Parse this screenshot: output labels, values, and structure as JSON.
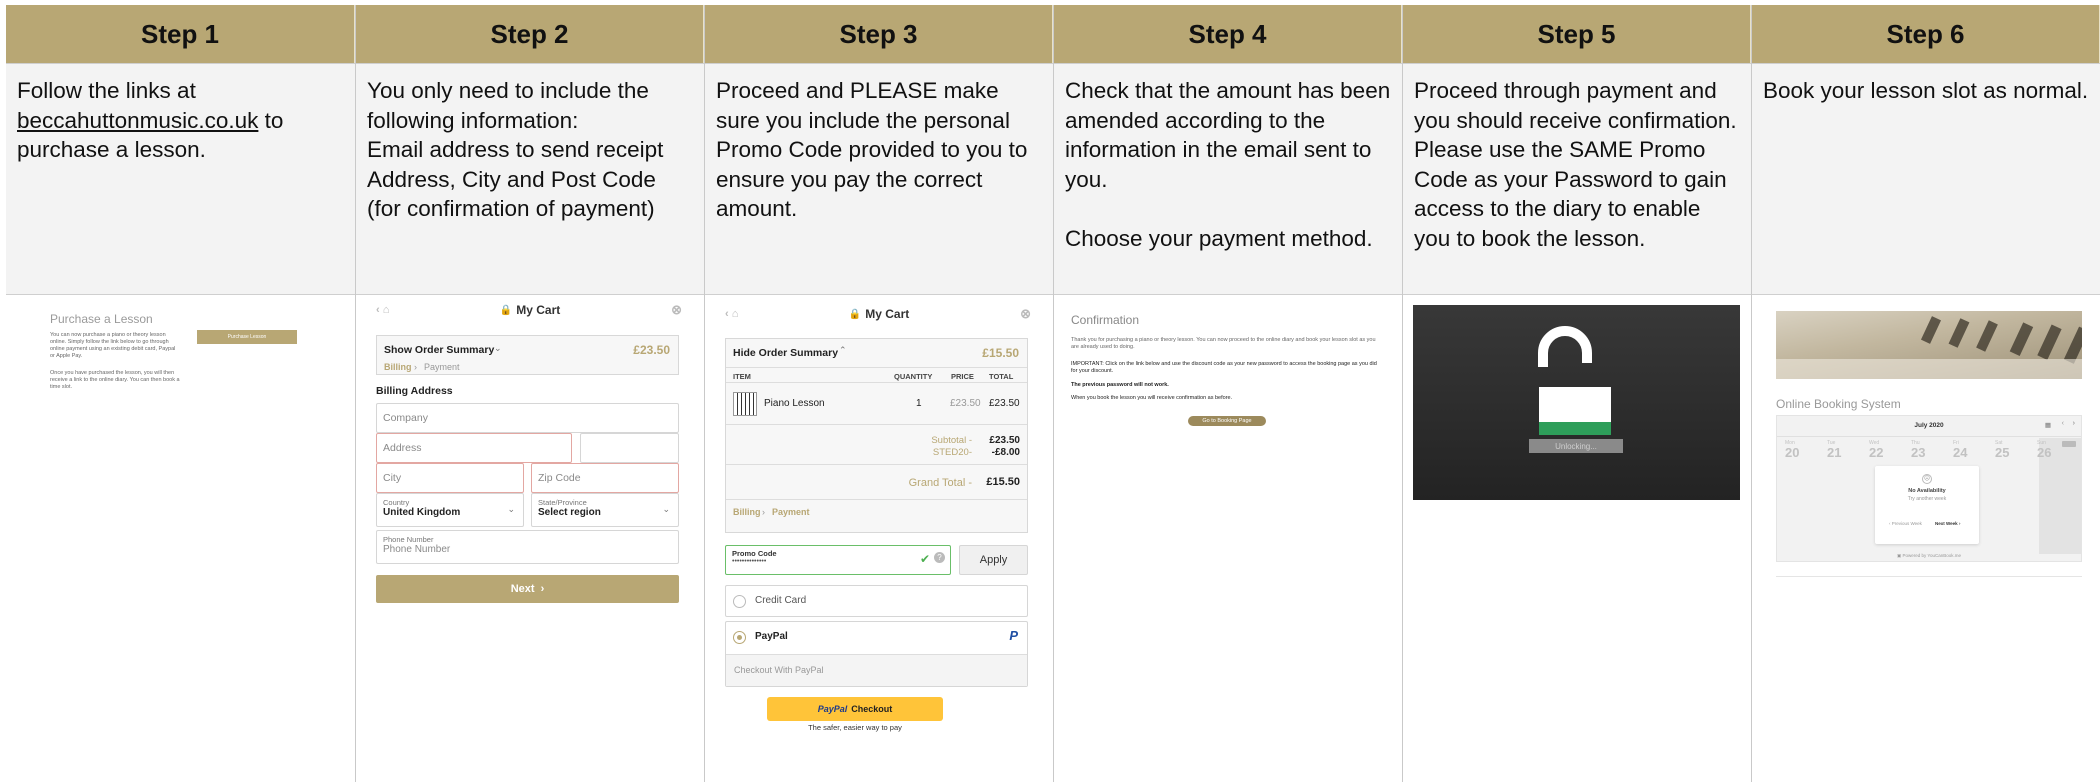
{
  "steps": [
    {
      "title": "Step 1",
      "text": ""
    },
    {
      "title": "Step 2",
      "text": "You only need to include the following information:\nEmail address to send receipt\nAddress, City and Post Code (for confirmation of payment)"
    },
    {
      "title": "Step 3",
      "text": "Proceed and PLEASE make sure you include the personal Promo Code provided to you to ensure you pay the correct amount."
    },
    {
      "title": "Step 4",
      "text": "Check that the amount has been amended according to the information in the email sent to you.\n\nChoose your payment method."
    },
    {
      "title": "Step 5",
      "text": "Proceed through payment and you should receive confirmation. Please use the SAME Promo Code as your Password to gain access to the diary to enable you to book the lesson."
    },
    {
      "title": "Step 6",
      "text": "Book your lesson slot as normal."
    }
  ],
  "step1": {
    "text_before": "Follow the links at ",
    "link": "beccahuttonmusic.co.uk",
    "text_after": " to purchase a lesson.",
    "shot_title": "Purchase a Lesson",
    "shot_para1": "You can now purchase a piano or theory lesson online. Simply follow the link below to go through online payment using an existing debit card, Paypal or Apple Pay.",
    "shot_para2": "Once you have purchased the lesson, you will then receive a link to the online diary. You can then book a time slot.",
    "shot_button": "Purchase Lesson"
  },
  "step2": {
    "cart_title": "My Cart",
    "summary_label": "Show Order Summary",
    "summary_total": "£23.50",
    "crumb_billing": "Billing",
    "crumb_payment": "Payment",
    "section": "Billing Address",
    "company": "Company",
    "address": "Address",
    "city": "City",
    "zip": "Zip Code",
    "country_label": "Country",
    "country_value": "United Kingdom",
    "state_label": "State/Province",
    "state_value": "Select region",
    "phone_label": "Phone Number",
    "phone_placeholder": "Phone Number",
    "next": "Next"
  },
  "step3": {
    "cart_title": "My Cart",
    "summary_label": "Hide Order Summary",
    "summary_total": "£15.50",
    "col_item": "ITEM",
    "col_qty": "QUANTITY",
    "col_price": "PRICE",
    "col_total": "TOTAL",
    "item_name": "Piano Lesson",
    "item_qty": "1",
    "item_price": "£23.50",
    "item_total": "£23.50",
    "subtotal_label": "Subtotal -",
    "subtotal_value": "£23.50",
    "discount_label": "STED20-",
    "discount_value": "-£8.00",
    "grand_label": "Grand Total -",
    "grand_value": "£15.50",
    "crumb_billing": "Billing",
    "crumb_payment": "Payment",
    "promo_label": "Promo Code",
    "promo_value": "••••••••••••••",
    "apply": "Apply",
    "credit_card": "Credit Card",
    "paypal": "PayPal",
    "checkout_with": "Checkout With PayPal",
    "paypal_btn_brand": "PayPal",
    "paypal_btn_text": "Checkout",
    "paypal_tagline": "The safer, easier way to pay"
  },
  "step4": {
    "title": "Confirmation",
    "p1": "Thank you for purchasing a piano or theory lesson. You can now proceed to the online diary and book your lesson slot as you are already used to doing.",
    "p2": "IMPORTANT: Click on the link below and use the discount code as your new password to access the booking page as you did for your discount.",
    "p3": "The previous password will not work.",
    "p4": "When you book the lesson you will receive confirmation as before.",
    "button": "Go to Booking Page"
  },
  "step5": {
    "unlocking": "Unlocking..."
  },
  "step6": {
    "title": "Online Booking System",
    "month": "July 2020",
    "days": [
      {
        "dow": "Mon",
        "num": "20"
      },
      {
        "dow": "Tue",
        "num": "21"
      },
      {
        "dow": "Wed",
        "num": "22"
      },
      {
        "dow": "Thu",
        "num": "23"
      },
      {
        "dow": "Fri",
        "num": "24"
      },
      {
        "dow": "Sat",
        "num": "25"
      },
      {
        "dow": "Sun",
        "num": "26"
      }
    ],
    "no_avail": "No Availability",
    "try_week": "Try another week",
    "prev_week": "Previous Week",
    "next_week": "Next Week",
    "powered": "Powered by YouCanBook.me"
  },
  "colors": {
    "header_gold": "#b8a774",
    "desc_bg": "#f3f3f3",
    "paypal_yellow": "#ffc439"
  }
}
